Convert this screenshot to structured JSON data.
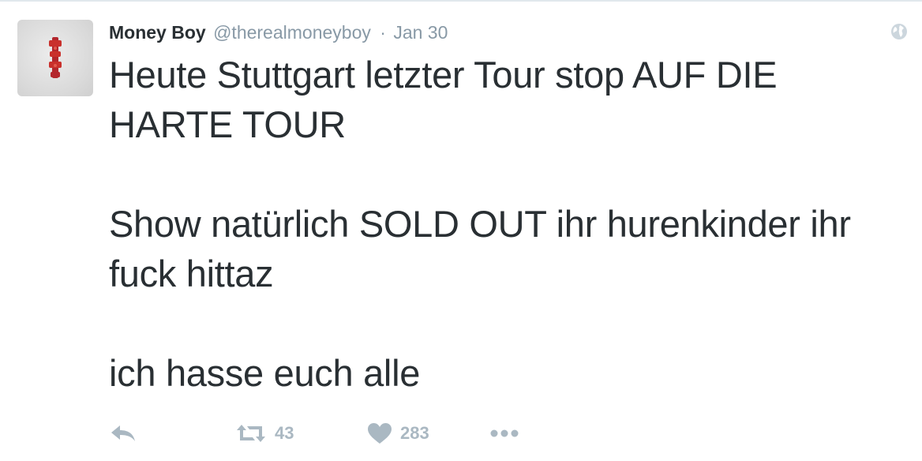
{
  "tweet": {
    "author": {
      "fullname": "Money Boy",
      "username": "@therealmoneyboy"
    },
    "separator": "·",
    "timestamp": "Jan 30",
    "text": "Heute Stuttgart letzter Tour stop AUF DIE HARTE TOUR\n\nShow natürlich SOLD OUT ihr hurenkinder ihr fuck hittaz\n\nich hasse euch alle",
    "actions": {
      "reply_icon": "reply-icon",
      "retweet_icon": "retweet-icon",
      "retweet_count": "43",
      "like_icon": "heart-icon",
      "like_count": "283",
      "more_icon": "more-dots-icon"
    },
    "visibility_icon": "globe-icon"
  },
  "colors": {
    "text": "#292f33",
    "muted": "#8899a6",
    "action": "#aab8c2",
    "border": "#e1e8ed"
  }
}
